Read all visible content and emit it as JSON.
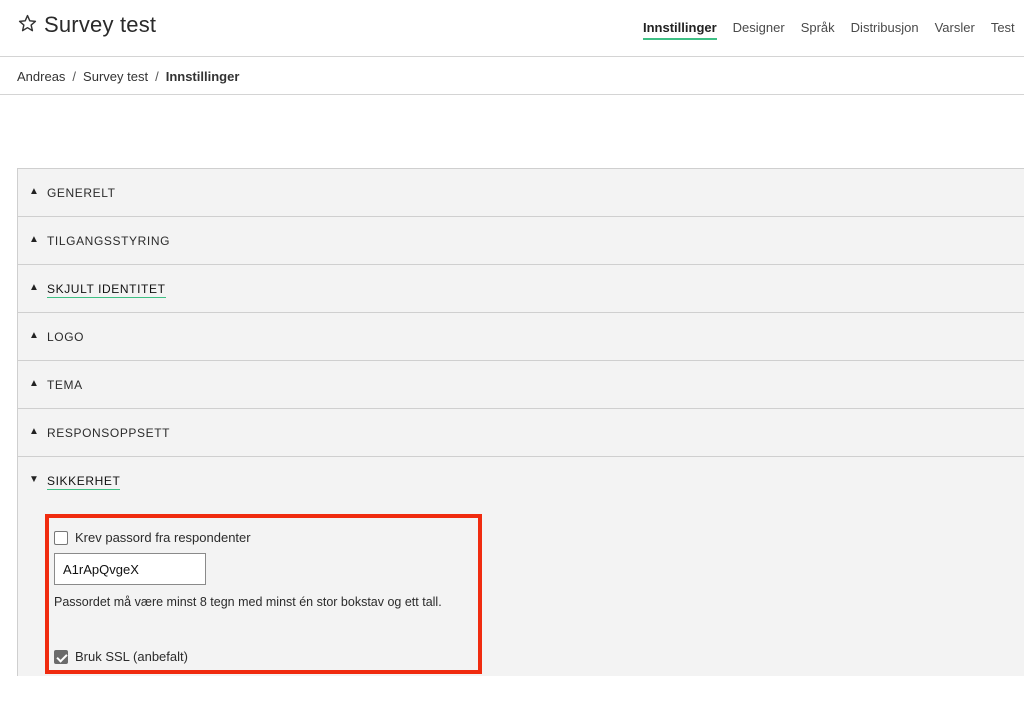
{
  "header": {
    "title": "Survey test",
    "star_icon": "star-outline-icon",
    "nav": [
      {
        "label": "Innstillinger",
        "active": true
      },
      {
        "label": "Designer"
      },
      {
        "label": "Språk"
      },
      {
        "label": "Distribusjon"
      },
      {
        "label": "Varsler"
      },
      {
        "label": "Test"
      }
    ]
  },
  "breadcrumb": {
    "items": [
      "Andreas",
      "Survey test",
      "Innstillinger"
    ],
    "separator": "/"
  },
  "sections": [
    {
      "label": "GENERELT",
      "arrow": "▲"
    },
    {
      "label": "TILGANGSSTYRING",
      "arrow": "▲"
    },
    {
      "label": "SKJULT IDENTITET",
      "arrow": "▲"
    },
    {
      "label": "LOGO",
      "arrow": "▲"
    },
    {
      "label": "TEMA",
      "arrow": "▲"
    },
    {
      "label": "RESPONSOPPSETT",
      "arrow": "▲"
    },
    {
      "label": "SIKKERHET",
      "arrow": "▼",
      "open": true
    }
  ],
  "security": {
    "require_password_label": "Krev passord fra respondenter",
    "require_password_checked": false,
    "password_value": "A1rApQvgeX",
    "password_hint": "Passordet må være minst 8 tegn med minst én stor bokstav og ett tall.",
    "ssl_label": "Bruk SSL (anbefalt)",
    "ssl_checked": true
  },
  "colors": {
    "accent": "#3dbf84",
    "highlight": "#f02b0f",
    "section_bg": "#f3f3f3"
  }
}
